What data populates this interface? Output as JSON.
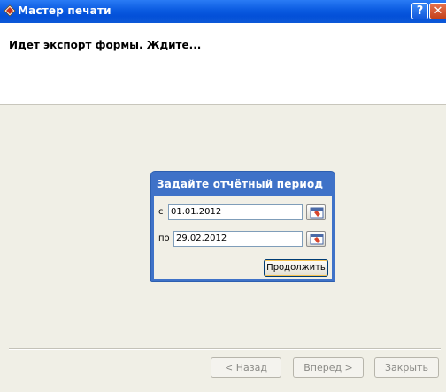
{
  "window": {
    "title": "Мастер печати",
    "help_glyph": "?",
    "close_glyph": "✕"
  },
  "header": {
    "message": "Идет экспорт формы. Ждите..."
  },
  "period_dialog": {
    "title": "Задайте отчётный период",
    "from_label": "с",
    "from_value": "01.01.2012",
    "to_label": "по",
    "to_value": "29.02.2012",
    "continue_label": "Продолжить"
  },
  "footer": {
    "back_label": "< Назад",
    "next_label": "Вперед >",
    "close_label": "Закрыть"
  },
  "colors": {
    "titlebar": "#0a5ae0",
    "dialog_frame": "#3f72c8"
  }
}
